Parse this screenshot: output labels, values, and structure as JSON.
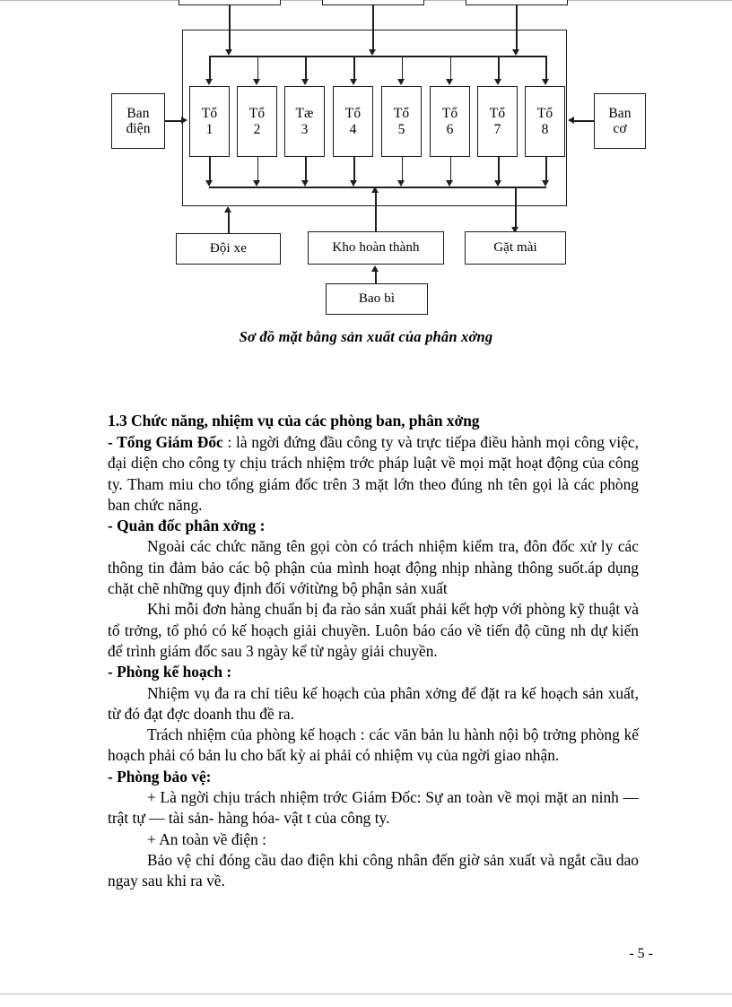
{
  "document": {
    "page_number": "- 5 -"
  },
  "diagram": {
    "caption": "Sơ đồ mặt bằng sản xuất của phân xởng",
    "top_boxes": [
      {
        "label": ""
      },
      {
        "label": ""
      },
      {
        "label": ""
      }
    ],
    "side_left": {
      "line1": "Ban",
      "line2": "điện"
    },
    "side_right": {
      "line1": "Ban",
      "line2": "cơ"
    },
    "units": [
      {
        "line1": "Tổ",
        "line2": "1"
      },
      {
        "line1": "Tổ",
        "line2": "2"
      },
      {
        "line1": "Tæ",
        "line2": "3"
      },
      {
        "line1": "Tổ",
        "line2": "4"
      },
      {
        "line1": "Tổ",
        "line2": "5"
      },
      {
        "line1": "Tổ",
        "line2": "6"
      },
      {
        "line1": "Tổ",
        "line2": "7"
      },
      {
        "line1": "Tổ",
        "line2": "8"
      }
    ],
    "bottom_boxes": [
      {
        "label": "Đội xe"
      },
      {
        "label": "Kho hoàn thành"
      },
      {
        "label": "Gặt mài"
      }
    ],
    "packaging_box": {
      "label": "Bao bì"
    }
  },
  "content": {
    "heading": "1.3 Chức năng, nhiệm vụ của các phòng ban, phân xởng",
    "s1_label": "- Tổng Giám Đốc",
    "s1_body": " : là ngời  đứng đầu công ty và trực tiếpa điều hành mọi công việc, đại diện cho công ty chịu trách nhiệm trớc  pháp luật về mọi mặt hoạt động của công ty. Tham miu cho tổng giám đốc trên 3 mặt lớn theo đúng nh  tên gọi là các phòng ban chức năng.",
    "s2_label": "- Quản đốc phân xởng   :",
    "s2_p1": "Ngoài các chức năng tên gọi còn có trách nhiệm kiểm tra, đôn đốc xử ly các thông tin đảm bảo các bộ phận của mình hoạt động  nhịp nhàng thông suốt.áp dụng chặt chẽ những quy định đối vớitừng bộ phận sản xuất",
    "s2_p2": "Khi mỗi đơn hàng chuẩn bị đa  rào sản xuất phải kết hợp với phòng kỹ thuật và tổ trởng,  tổ phó có kế hoạch giải chuyền.  Luôn báo cáo về tiến độ cũng nh  dự kiến để trình giám đốc sau 3 ngày kể từ ngày giải chuyền.",
    "s3_label": "- Phòng kế hoạch :",
    "s3_p1": "Nhiệm vụ đa   ra chỉ tiêu kế hoạch của phân xởng   để đặt ra kế hoạch sản xuất, từ đó đạt đợc   doanh thu đề ra.",
    "s3_p2": "Trách nhiệm của phòng kế hoạch : các văn bản lu   hành nội bộ trởng  phòng kế hoạch phải có bản lu  cho bất kỳ ai phải có nhiệm vụ của ngời  giao nhận.",
    "s4_label": "- Phòng bảo vệ:",
    "s4_p1": "+ Là ngời   chịu trách nhiệm trớc   Giám Đốc:  Sự an toàn về mọi mặt an ninh — trật tự — tài sản- hàng hóa- vật t   của công ty.",
    "s4_p2": "+ An toàn về điện :",
    "s4_p3": "Bảo vệ chỉ đóng cầu dao điện khi công nhân đến giờ sản xuất và ngắt cầu dao ngay sau khi ra về."
  }
}
